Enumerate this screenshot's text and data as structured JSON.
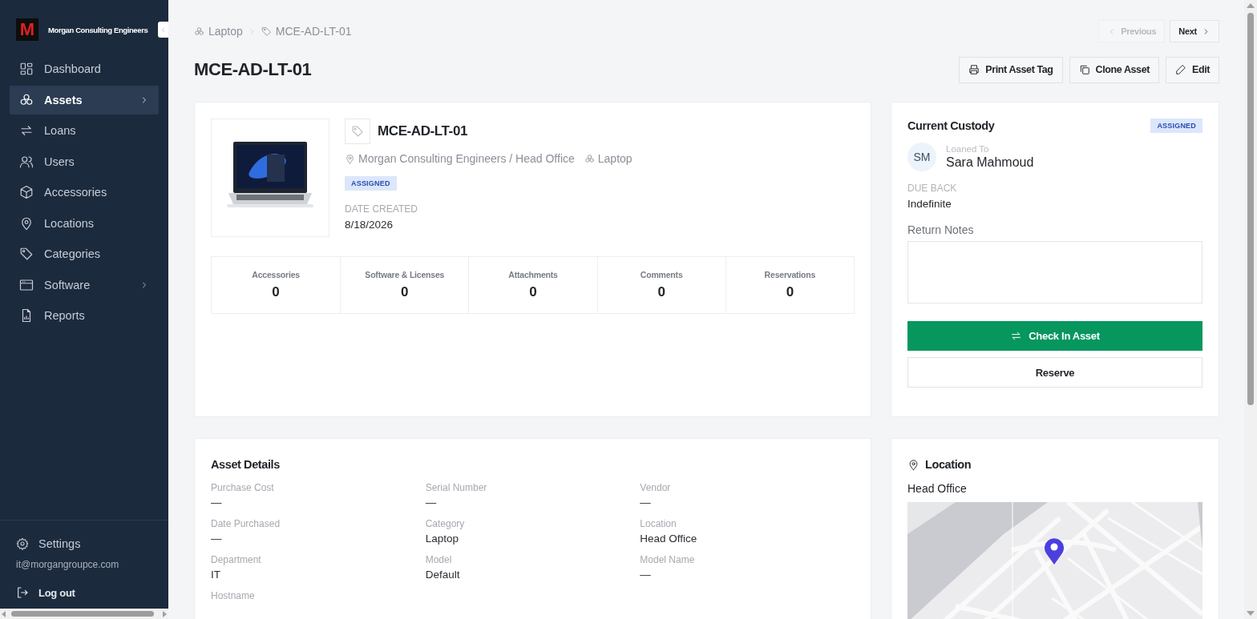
{
  "sidebar": {
    "brand": {
      "logo_letter": "M",
      "name": "Morgan Consulting Engineers"
    },
    "items": [
      {
        "label": "Dashboard",
        "selected": false,
        "has_submenu": false
      },
      {
        "label": "Assets",
        "selected": true,
        "has_submenu": true
      },
      {
        "label": "Loans",
        "selected": false,
        "has_submenu": false
      },
      {
        "label": "Users",
        "selected": false,
        "has_submenu": false
      },
      {
        "label": "Accessories",
        "selected": false,
        "has_submenu": false
      },
      {
        "label": "Locations",
        "selected": false,
        "has_submenu": false
      },
      {
        "label": "Categories",
        "selected": false,
        "has_submenu": false
      },
      {
        "label": "Software",
        "selected": false,
        "has_submenu": true
      },
      {
        "label": "Reports",
        "selected": false,
        "has_submenu": false
      }
    ],
    "settings": "Settings",
    "email": "it@morgangroupce.com",
    "logout": "Log out"
  },
  "breadcrumb": [
    {
      "label": "Laptop"
    },
    {
      "label": "MCE-AD-LT-01"
    }
  ],
  "pager": [
    {
      "label": "Previous",
      "disabled": true
    },
    {
      "label": "Next",
      "disabled": false
    }
  ],
  "page_title": "MCE-AD-LT-01",
  "actions": [
    {
      "label": "Print Asset Tag"
    },
    {
      "label": "Clone Asset"
    },
    {
      "label": "Edit"
    }
  ],
  "asset": {
    "tag": "MCE-AD-LT-01",
    "location": "Morgan Consulting Engineers / Head Office",
    "category": "Laptop",
    "status": "ASSIGNED",
    "date_created_label": "DATE CREATED",
    "date_created": "8/18/2026"
  },
  "counts": [
    {
      "label": "Accessories",
      "value": "0"
    },
    {
      "label": "Software & Licenses",
      "value": "0"
    },
    {
      "label": "Attachments",
      "value": "0"
    },
    {
      "label": "Comments",
      "value": "0"
    },
    {
      "label": "Reservations",
      "value": "0"
    }
  ],
  "custody": {
    "title": "Current Custody",
    "status": "ASSIGNED",
    "initials": "SM",
    "loaned_to_label": "Loaned To",
    "name": "Sara Mahmoud",
    "due_label": "DUE BACK",
    "due": "Indefinite",
    "notes_label": "Return Notes",
    "check_in": "Check In Asset",
    "reserve": "Reserve"
  },
  "details": {
    "title": "Asset Details",
    "fields": [
      {
        "label": "Purchase Cost",
        "value": "—"
      },
      {
        "label": "Serial Number",
        "value": "—"
      },
      {
        "label": "Vendor",
        "value": "—"
      },
      {
        "label": "Date Purchased",
        "value": "—"
      },
      {
        "label": "Category",
        "value": "Laptop"
      },
      {
        "label": "Location",
        "value": "Head Office"
      },
      {
        "label": "Department",
        "value": "IT"
      },
      {
        "label": "Model",
        "value": "Default"
      },
      {
        "label": "Model Name",
        "value": "—"
      },
      {
        "label": "Hostname"
      }
    ]
  },
  "location": {
    "title": "Location",
    "name": "Head Office"
  }
}
